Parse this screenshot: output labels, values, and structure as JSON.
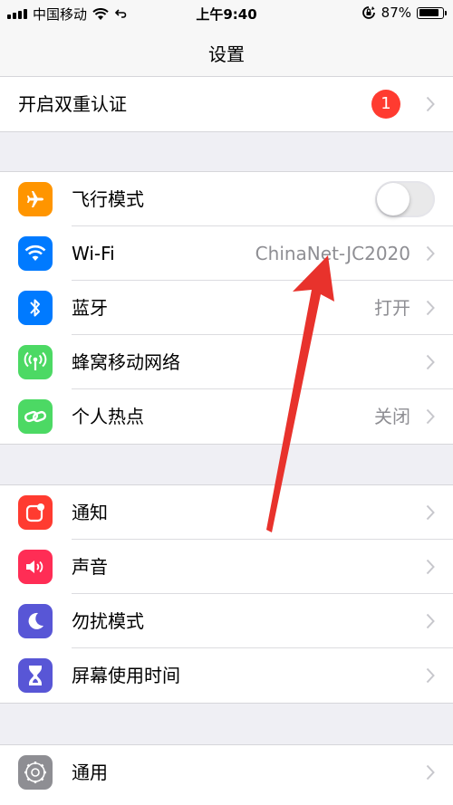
{
  "status_bar": {
    "carrier": "中国移动",
    "time": "上午9:40",
    "battery_percent": "87%",
    "battery_level": 0.87
  },
  "nav": {
    "title": "设置"
  },
  "two_factor": {
    "label": "开启双重认证",
    "badge": "1"
  },
  "network": {
    "airplane": {
      "label": "飞行模式",
      "on": false,
      "color": "#ff9500"
    },
    "wifi": {
      "label": "Wi-Fi",
      "value": "ChinaNet-JC2020",
      "color": "#007aff"
    },
    "bluetooth": {
      "label": "蓝牙",
      "value": "打开",
      "color": "#007aff"
    },
    "cellular": {
      "label": "蜂窝移动网络",
      "color": "#4cd964"
    },
    "hotspot": {
      "label": "个人热点",
      "value": "关闭",
      "color": "#4cd964"
    }
  },
  "notifications_group": {
    "notifications": {
      "label": "通知",
      "color": "#ff3b30"
    },
    "sounds": {
      "label": "声音",
      "color": "#ff2d55"
    },
    "dnd": {
      "label": "勿扰模式",
      "color": "#5856d6"
    },
    "screen_time": {
      "label": "屏幕使用时间",
      "color": "#5856d6"
    }
  },
  "general_group": {
    "general": {
      "label": "通用",
      "color": "#8e8e93"
    }
  },
  "annotation_arrow": {
    "color": "#e8322c"
  }
}
